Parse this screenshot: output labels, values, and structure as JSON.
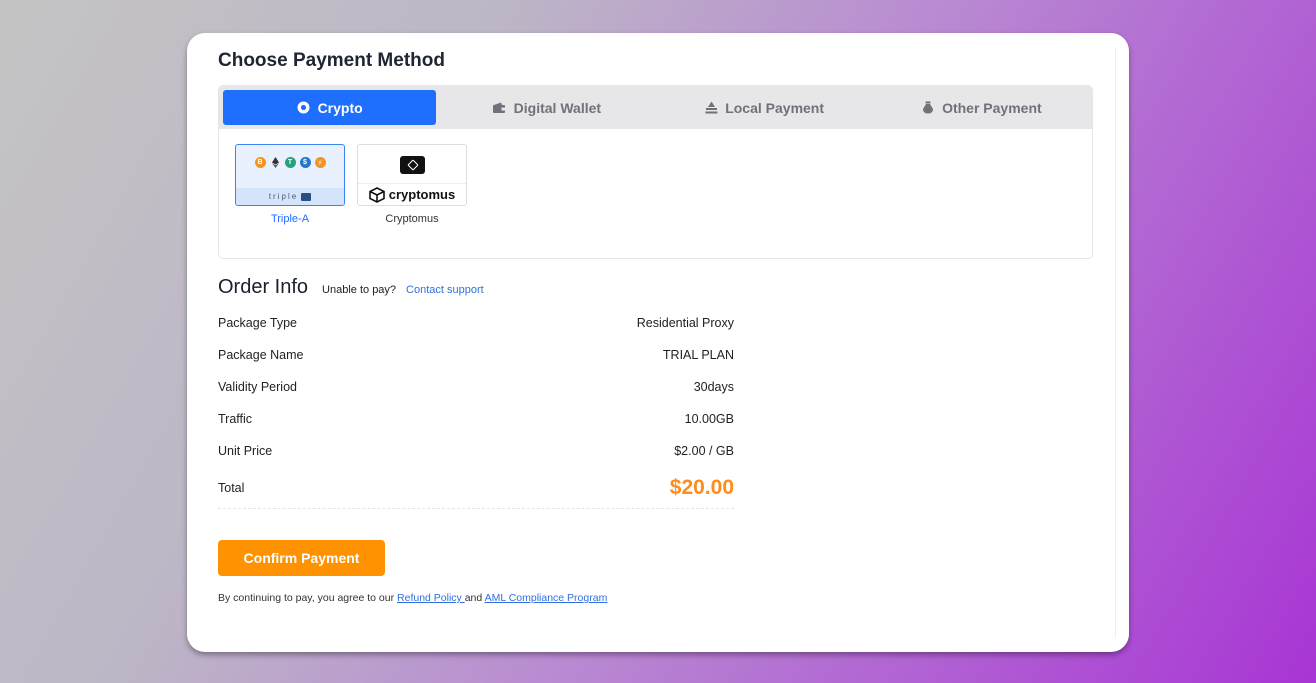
{
  "page": {
    "title": "Choose Payment Method"
  },
  "tabs": [
    {
      "label": "Crypto",
      "icon": "crypto-icon",
      "active": true
    },
    {
      "label": "Digital Wallet",
      "icon": "wallet-icon",
      "active": false
    },
    {
      "label": "Local Payment",
      "icon": "bank-icon",
      "active": false
    },
    {
      "label": "Other Payment",
      "icon": "money-bag-icon",
      "active": false
    }
  ],
  "methods": [
    {
      "name": "Triple-A",
      "logo_text": "triple",
      "selected": true
    },
    {
      "name": "Cryptomus",
      "logo_text": "cryptomus",
      "selected": false
    }
  ],
  "order": {
    "title": "Order Info",
    "unable": "Unable to pay?",
    "contact": "Contact support",
    "rows": [
      {
        "label": "Package Type",
        "value": "Residential Proxy"
      },
      {
        "label": "Package Name",
        "value": "TRIAL PLAN"
      },
      {
        "label": "Validity Period",
        "value": "30days"
      },
      {
        "label": "Traffic",
        "value": "10.00GB"
      },
      {
        "label": "Unit Price",
        "value": "$2.00 / GB"
      }
    ],
    "total_label": "Total",
    "total_value": "$20.00"
  },
  "confirm_label": "Confirm Payment",
  "terms": {
    "prefix": "By continuing to pay, you agree to our",
    "refund": "Refund Policy ",
    "and": " and ",
    "aml": "AML Compliance Program"
  },
  "colors": {
    "primary": "#1f6fff",
    "accent": "#ff9200",
    "total": "#ff8c1a"
  }
}
